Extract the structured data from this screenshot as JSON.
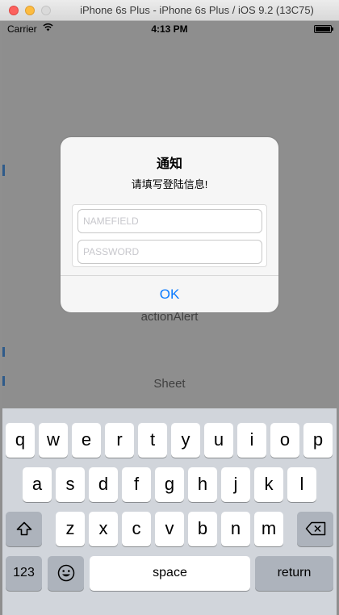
{
  "window": {
    "title": "iPhone 6s Plus - iPhone 6s Plus / iOS 9.2 (13C75)"
  },
  "status_bar": {
    "carrier": "Carrier",
    "time": "4:13 PM"
  },
  "background": {
    "action_alert_label": "actionAlert",
    "sheet_label": "Sheet"
  },
  "alert": {
    "title": "通知",
    "message": "请填写登陆信息!",
    "name_placeholder": "NAMEFIELD",
    "password_placeholder": "PASSWORD",
    "ok_label": "OK",
    "button_color": "#0a7aff"
  },
  "keyboard": {
    "row1": [
      "q",
      "w",
      "e",
      "r",
      "t",
      "y",
      "u",
      "i",
      "o",
      "p"
    ],
    "row2": [
      "a",
      "s",
      "d",
      "f",
      "g",
      "h",
      "j",
      "k",
      "l"
    ],
    "row3": [
      "z",
      "x",
      "c",
      "v",
      "b",
      "n",
      "m"
    ],
    "numbers_label": "123",
    "space_label": "space",
    "return_label": "return",
    "shift_icon": "shift-icon",
    "delete_icon": "delete-icon",
    "emoji_icon": "emoji-icon"
  }
}
